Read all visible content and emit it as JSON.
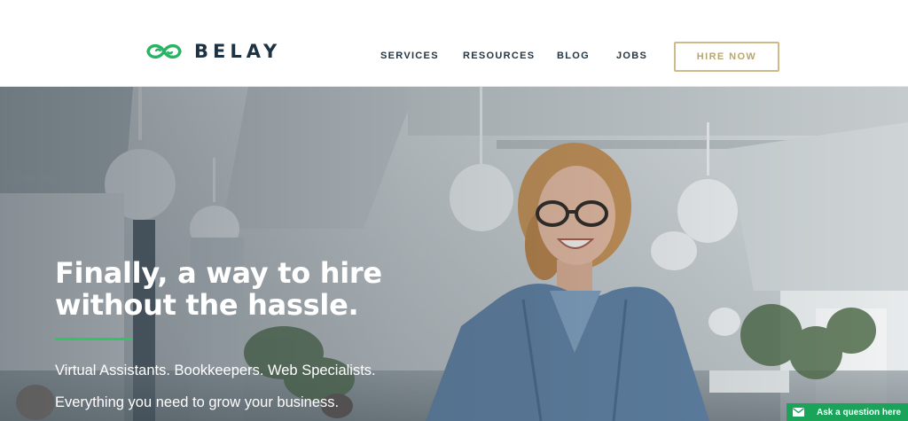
{
  "brand": {
    "name": "BELAY",
    "logo_icon": "infinity-loop-icon",
    "color": "#1d3343",
    "accent": "#28b463"
  },
  "nav": {
    "items": [
      {
        "label": "SERVICES"
      },
      {
        "label": "RESOURCES"
      },
      {
        "label": "BLOG"
      },
      {
        "label": "JOBS"
      }
    ],
    "cta_label": "HIRE NOW",
    "cta_color": "#cdbb8b"
  },
  "hero": {
    "headline_line1": "Finally, a way to hire",
    "headline_line2": "without the hassle.",
    "subline1": "Virtual Assistants. Bookkeepers. Web Specialists.",
    "subline2": "Everything you need to grow your business.",
    "accent_line_color": "#2fc468"
  },
  "chat": {
    "label": "Ask a question here",
    "icon": "envelope-icon",
    "color": "#1aa45a"
  }
}
